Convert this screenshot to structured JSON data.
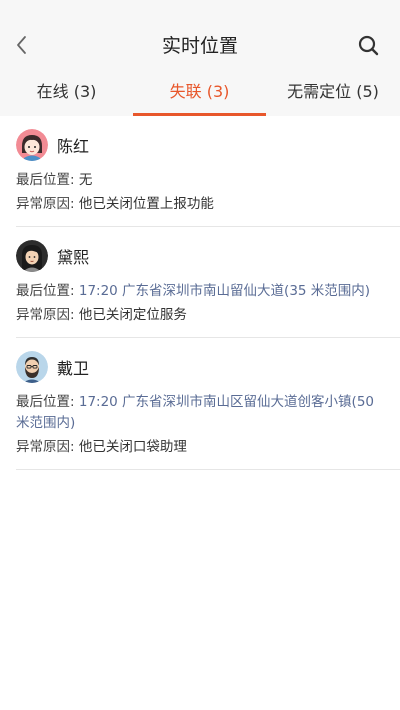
{
  "header": {
    "title": "实时位置"
  },
  "tabs": [
    {
      "label": "在线 (3)",
      "active": false
    },
    {
      "label": "失联 (3)",
      "active": true
    },
    {
      "label": "无需定位 (5)",
      "active": false
    }
  ],
  "colors": {
    "accent": "#e8572b",
    "link": "#5a6c95"
  },
  "people": [
    {
      "name": "陈红",
      "last_location_label": "最后位置:",
      "last_location": "无",
      "reason_label": "异常原因:",
      "reason": "他已关闭位置上报功能",
      "avatar_icon": "avatar-woman-red-hair-icon"
    },
    {
      "name": "黛熙",
      "last_location_label": "最后位置:",
      "last_location": "17:20 广东省深圳市南山留仙大道(35 米范围内)",
      "reason_label": "异常原因:",
      "reason": "他已关闭定位服务",
      "avatar_icon": "avatar-woman-dark-icon"
    },
    {
      "name": "戴卫",
      "last_location_label": "最后位置:",
      "last_location": "17:20 广东省深圳市南山区留仙大道创客小镇(50米范围内)",
      "reason_label": "异常原因:",
      "reason": "他已关闭口袋助理",
      "avatar_icon": "avatar-man-beard-icon"
    }
  ]
}
